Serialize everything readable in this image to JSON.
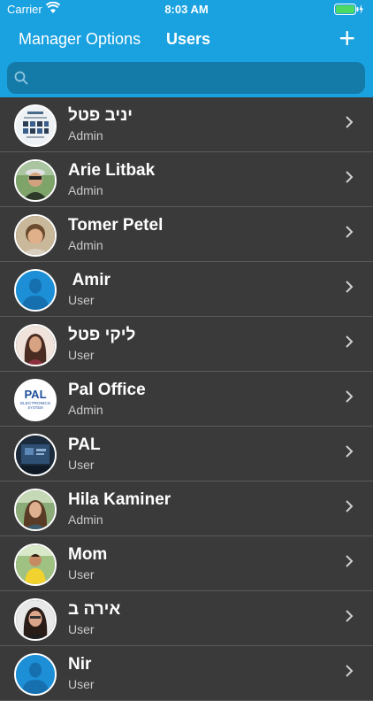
{
  "status": {
    "carrier": "Carrier",
    "time": "8:03 AM"
  },
  "nav": {
    "back_label": "Manager Options",
    "title": "Users",
    "add_label": "+"
  },
  "search": {
    "placeholder": ""
  },
  "users": [
    {
      "name": "יניב פטל",
      "role": "Admin",
      "avatar": "brochure"
    },
    {
      "name": "Arie Litbak",
      "role": "Admin",
      "avatar": "photo"
    },
    {
      "name": "Tomer Petel",
      "role": "Admin",
      "avatar": "photo"
    },
    {
      "name": " Amir",
      "role": "User",
      "avatar": "default-person-icon"
    },
    {
      "name": "ליקי פטל",
      "role": "User",
      "avatar": "photo"
    },
    {
      "name": "Pal Office",
      "role": "Admin",
      "avatar": "logo",
      "avatar_text": [
        "PAL",
        "ELECTRONICS",
        "SYSTEM"
      ]
    },
    {
      "name": "PAL",
      "role": "User",
      "avatar": "photo"
    },
    {
      "name": "Hila Kaminer",
      "role": "Admin",
      "avatar": "photo"
    },
    {
      "name": "Mom",
      "role": "User",
      "avatar": "photo"
    },
    {
      "name": "אירה ב",
      "role": "User",
      "avatar": "photo"
    },
    {
      "name": "Nir",
      "role": "User",
      "avatar": "default-person-icon"
    }
  ],
  "colors": {
    "accent": "#19a1e0",
    "background": "#3a3a3a"
  }
}
